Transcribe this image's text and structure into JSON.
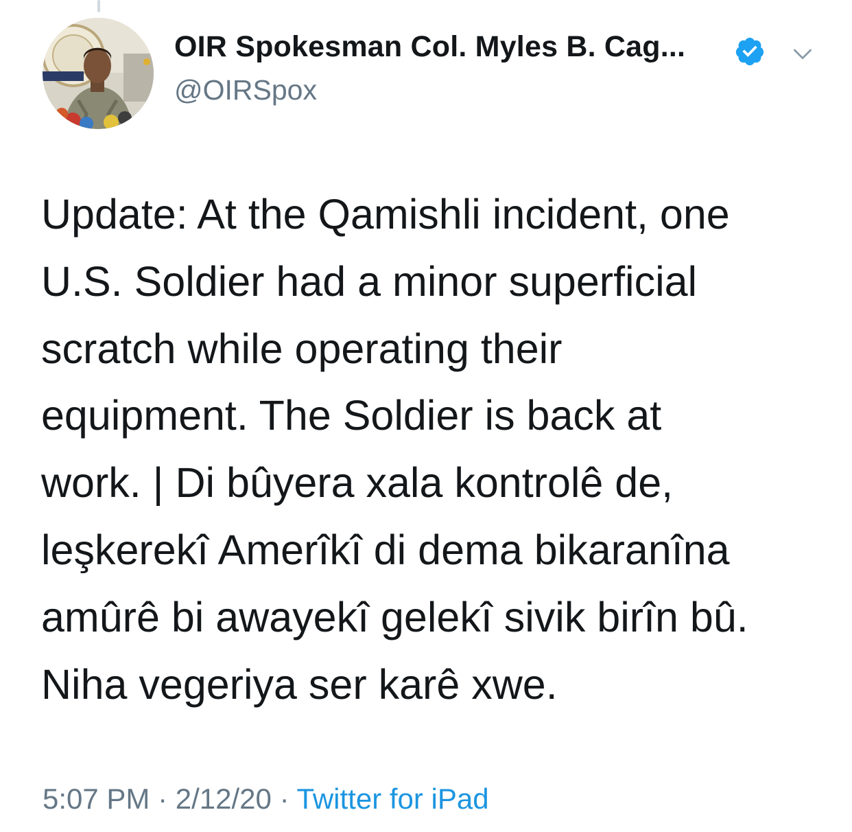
{
  "tweet": {
    "author": {
      "display_name": "OIR Spokesman Col. Myles B. Cag...",
      "handle": "@OIRSpox",
      "verified": true,
      "avatar": "profile-photo"
    },
    "text_lines": [
      "Update: At the Qamishli incident, one",
      "U.S. Soldier had a minor superficial",
      "scratch while operating their",
      "equipment. The Soldier is back at",
      "work. | Di bûyera xala kontrolê de,",
      "leşkerekî Amerîkî di dema bikaranîna",
      "amûrê bi awayekî gelekî sivik birîn bû.",
      "Niha vegeriya ser karê xwe."
    ],
    "time": "5:07 PM",
    "date": "2/12/20",
    "separator": "·",
    "source": "Twitter for iPad"
  },
  "icons": {
    "verified": "verified-badge-icon",
    "menu": "chevron-down-icon"
  },
  "colors": {
    "text": "#14171a",
    "secondary": "#657786",
    "link": "#1b95e0",
    "verified": "#1da1f2"
  }
}
